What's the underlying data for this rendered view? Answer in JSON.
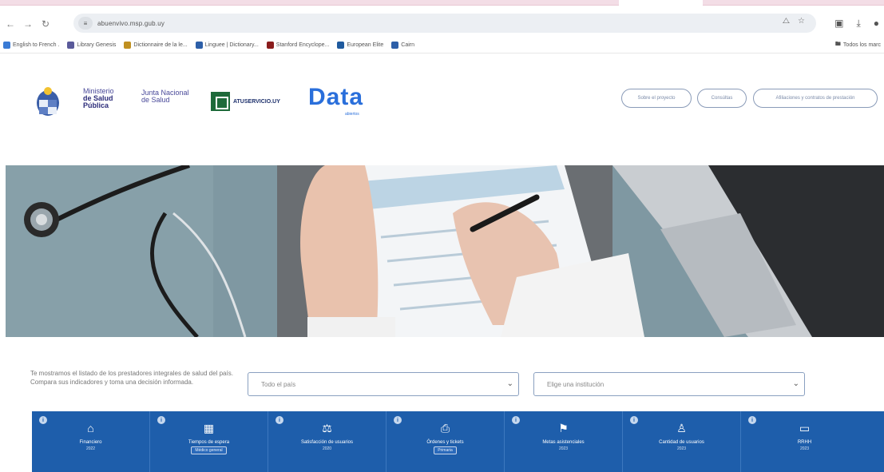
{
  "browser": {
    "url": "abuenvivo.msp.gub.uy",
    "site_info": "≡",
    "bookmarks": [
      {
        "label": "English to French .",
        "color": "#3a7bd5"
      },
      {
        "label": "Library Genesis",
        "color": "#5a5a9a"
      },
      {
        "label": "Dictionnaire de la le...",
        "color": "#c09020"
      },
      {
        "label": "Linguee | Dictionary...",
        "color": "#2d5fa8"
      },
      {
        "label": "Stanford Encyclope...",
        "color": "#8a1c1c"
      },
      {
        "label": "European Elite",
        "color": "#1f5a9e"
      },
      {
        "label": "Cairn",
        "color": "#2d5fa8"
      }
    ],
    "bookmark_folder": "Todos los marc"
  },
  "header": {
    "msp_line1": "Ministerio",
    "msp_line2": "de Salud",
    "msp_line3": "Pública",
    "jns_line1": "Junta Nacional",
    "jns_line2": "de Salud",
    "atu_text": "ATUSERVICIO.UY",
    "data_logo": "Data",
    "data_sub": "abiertos",
    "buttons": [
      "Sobre el proyecto",
      "Consúltas",
      "Afiliaciones y contratos de prestación"
    ]
  },
  "filters": {
    "intro": "Te mostramos el listado de los prestadores integrales de salud del país. Compara sus indicadores y toma una decisión informada.",
    "select1": "Todo el país",
    "select2": "Elige una institución"
  },
  "tiles": [
    {
      "label": "Financiero",
      "sub": "2022",
      "icon": "home-icon",
      "glyph": "⌂",
      "select": ""
    },
    {
      "label": "Tiempos de espera",
      "sub": "",
      "icon": "calendar-icon",
      "glyph": "▦",
      "select": "Médico general"
    },
    {
      "label": "Satisfacción de usuarios",
      "sub": "2020",
      "icon": "scale-icon",
      "glyph": "⚖",
      "select": ""
    },
    {
      "label": "Órdenes y tickets",
      "sub": "",
      "icon": "ticket-icon",
      "glyph": "⎙",
      "select": "Primaria"
    },
    {
      "label": "Metas asistenciales",
      "sub": "2023",
      "icon": "flag-icon",
      "glyph": "⚑",
      "select": ""
    },
    {
      "label": "Cantidad de usuarios",
      "sub": "2023",
      "icon": "user-icon",
      "glyph": "♙",
      "select": ""
    },
    {
      "label": "RRHH",
      "sub": "2023",
      "icon": "folder-icon",
      "glyph": "▭",
      "select": ""
    }
  ]
}
